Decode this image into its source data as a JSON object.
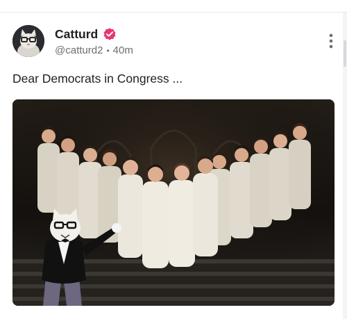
{
  "post": {
    "author": {
      "display_name": "Catturd",
      "handle": "@catturd2",
      "verified": true,
      "avatar_icon": "cat-with-glasses-avatar"
    },
    "time_ago": "40m",
    "separator": "•",
    "text": "Dear Democrats in Congress ...",
    "image": {
      "subject": "choir-meme-image",
      "icon": "choir-singers-with-cat-conductor"
    },
    "menu_icon": "vertical-ellipsis-icon"
  },
  "colors": {
    "verified_badge": "#e8366f",
    "text_primary": "#1f1f22",
    "text_secondary": "#6d6d75",
    "divider": "#e9e9ee"
  }
}
